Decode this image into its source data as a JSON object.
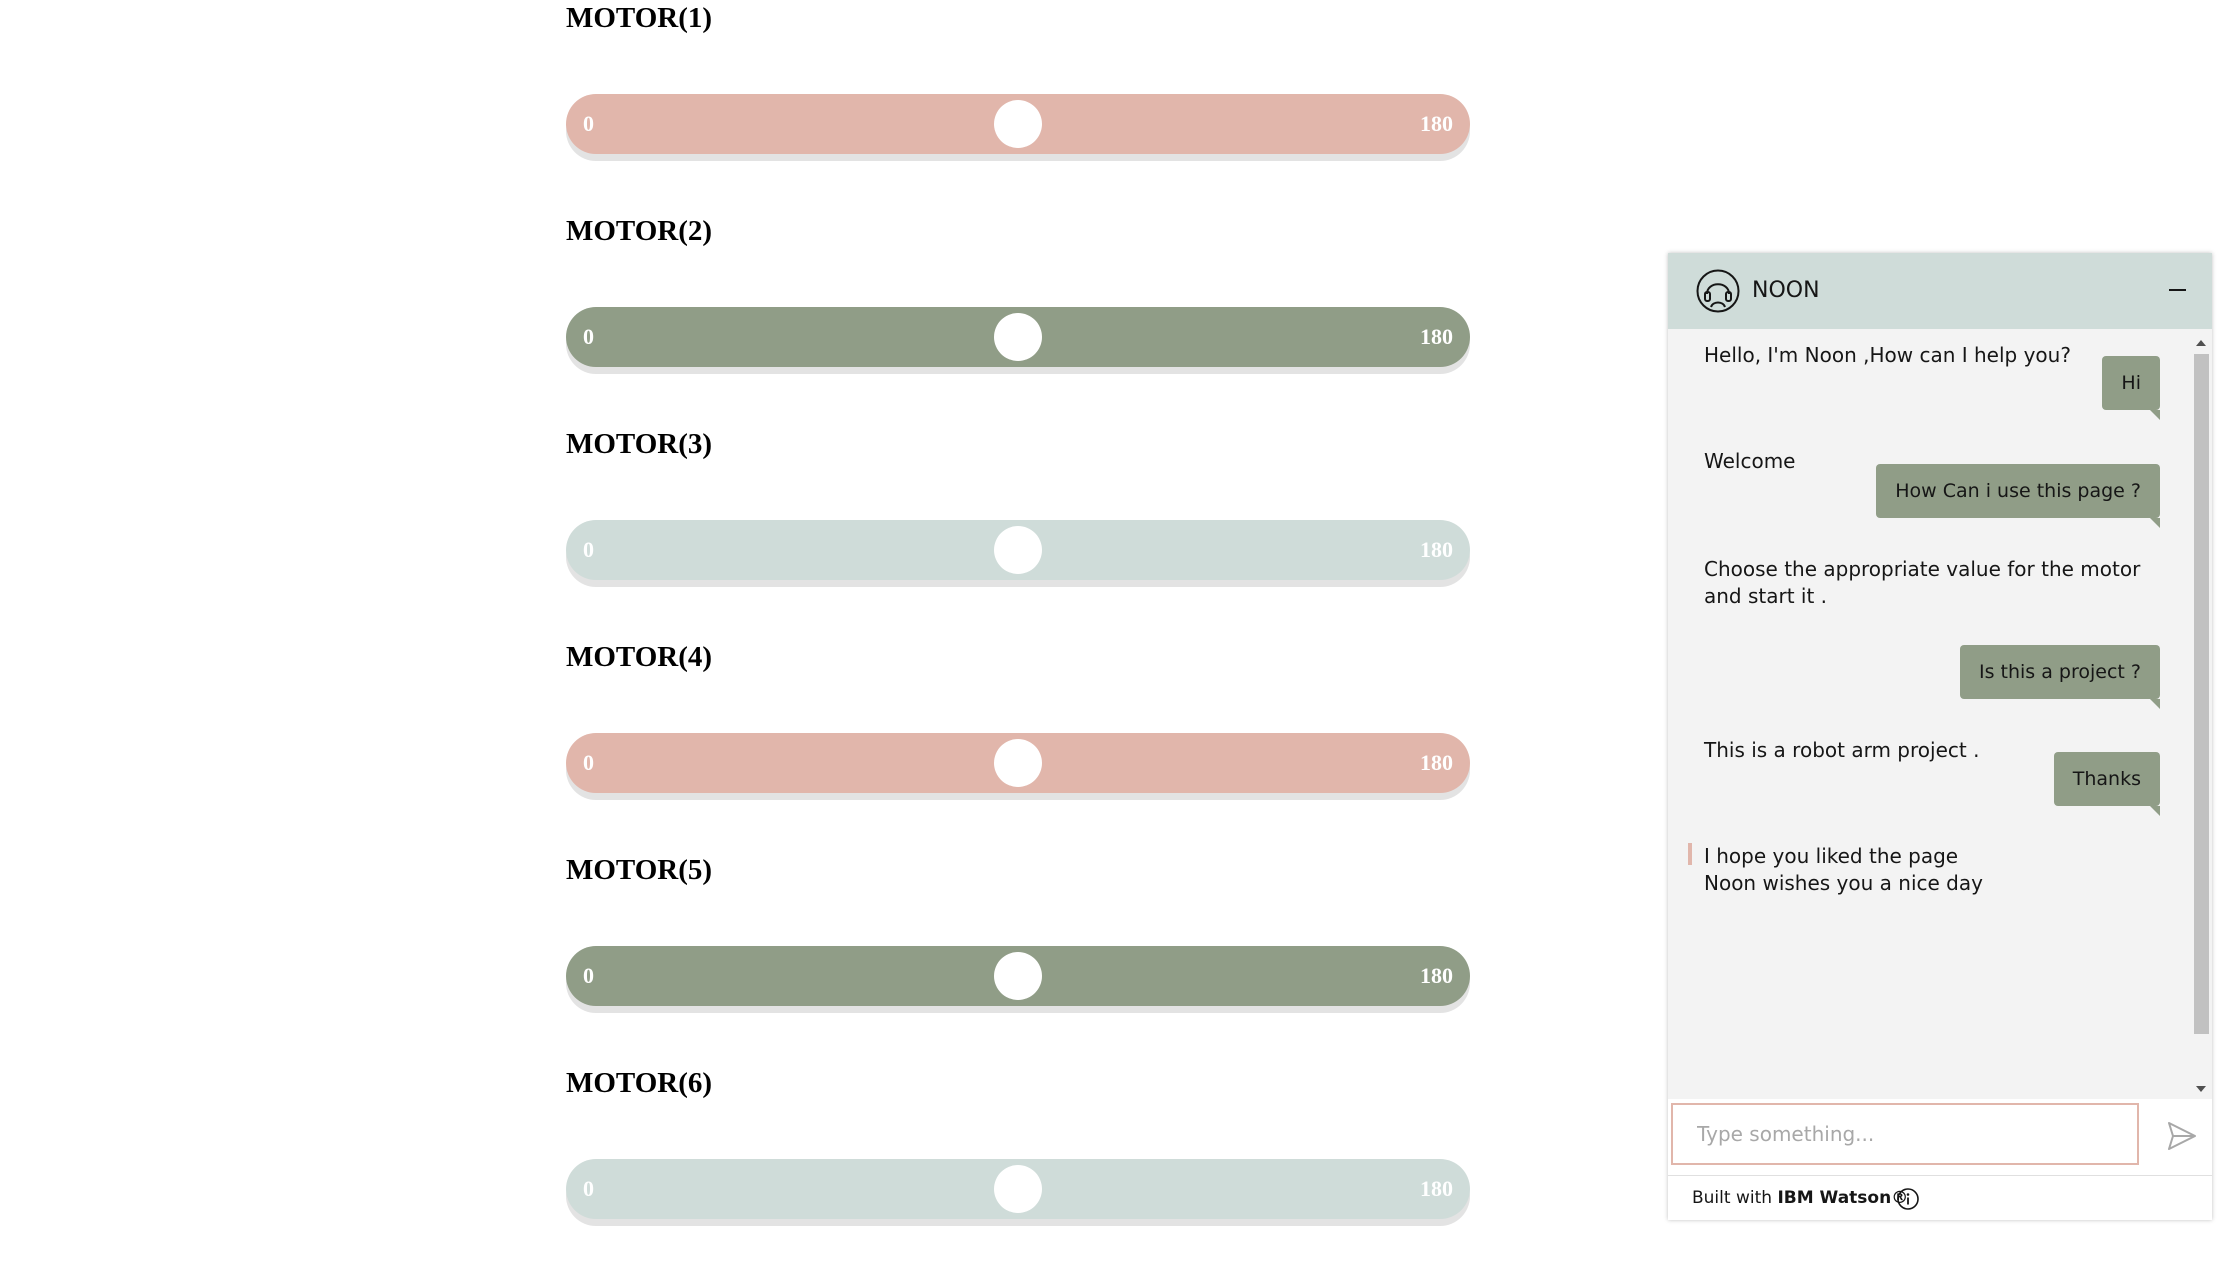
{
  "motors": [
    {
      "title": "MOTOR(1)",
      "min": "0",
      "max": "180",
      "value": 90,
      "color": "#e1b6ab"
    },
    {
      "title": "MOTOR(2)",
      "min": "0",
      "max": "180",
      "value": 90,
      "color": "#909d87"
    },
    {
      "title": "MOTOR(3)",
      "min": "0",
      "max": "180",
      "value": 90,
      "color": "#cfdcd9"
    },
    {
      "title": "MOTOR(4)",
      "min": "0",
      "max": "180",
      "value": 90,
      "color": "#e1b6ab"
    },
    {
      "title": "MOTOR(5)",
      "min": "0",
      "max": "180",
      "value": 90,
      "color": "#909d87"
    },
    {
      "title": "MOTOR(6)",
      "min": "0",
      "max": "180",
      "value": 90,
      "color": "#cfdcd9"
    }
  ],
  "chat": {
    "title": "NOON",
    "header_color": "#cfdcd9",
    "user_bubble_color": "#909d87",
    "accent_color": "#e1b6ab",
    "icons": {
      "avatar": "user-headset-icon",
      "minimize": "minimize-icon",
      "send": "send-icon",
      "help": "help-icon",
      "info": "info-icon"
    },
    "messages": [
      {
        "from": "bot",
        "text": "Hello, I'm Noon ,How can I help you?"
      },
      {
        "from": "user",
        "text": "Hi"
      },
      {
        "from": "bot",
        "text": "Welcome"
      },
      {
        "from": "user",
        "text": "How Can i use this page ?"
      },
      {
        "from": "bot",
        "text": "Choose the appropriate value for the motor and start it ."
      },
      {
        "from": "user",
        "text": "Is this a project ?"
      },
      {
        "from": "bot",
        "text": "This is a robot arm project ."
      },
      {
        "from": "user",
        "text": "Thanks"
      },
      {
        "from": "bot",
        "line1": "I hope you liked the page",
        "line2": "Noon wishes you a nice day"
      }
    ],
    "help_label": "?",
    "input_placeholder": "Type something...",
    "footer_prefix": "Built with ",
    "footer_brand": "IBM Watson®"
  }
}
